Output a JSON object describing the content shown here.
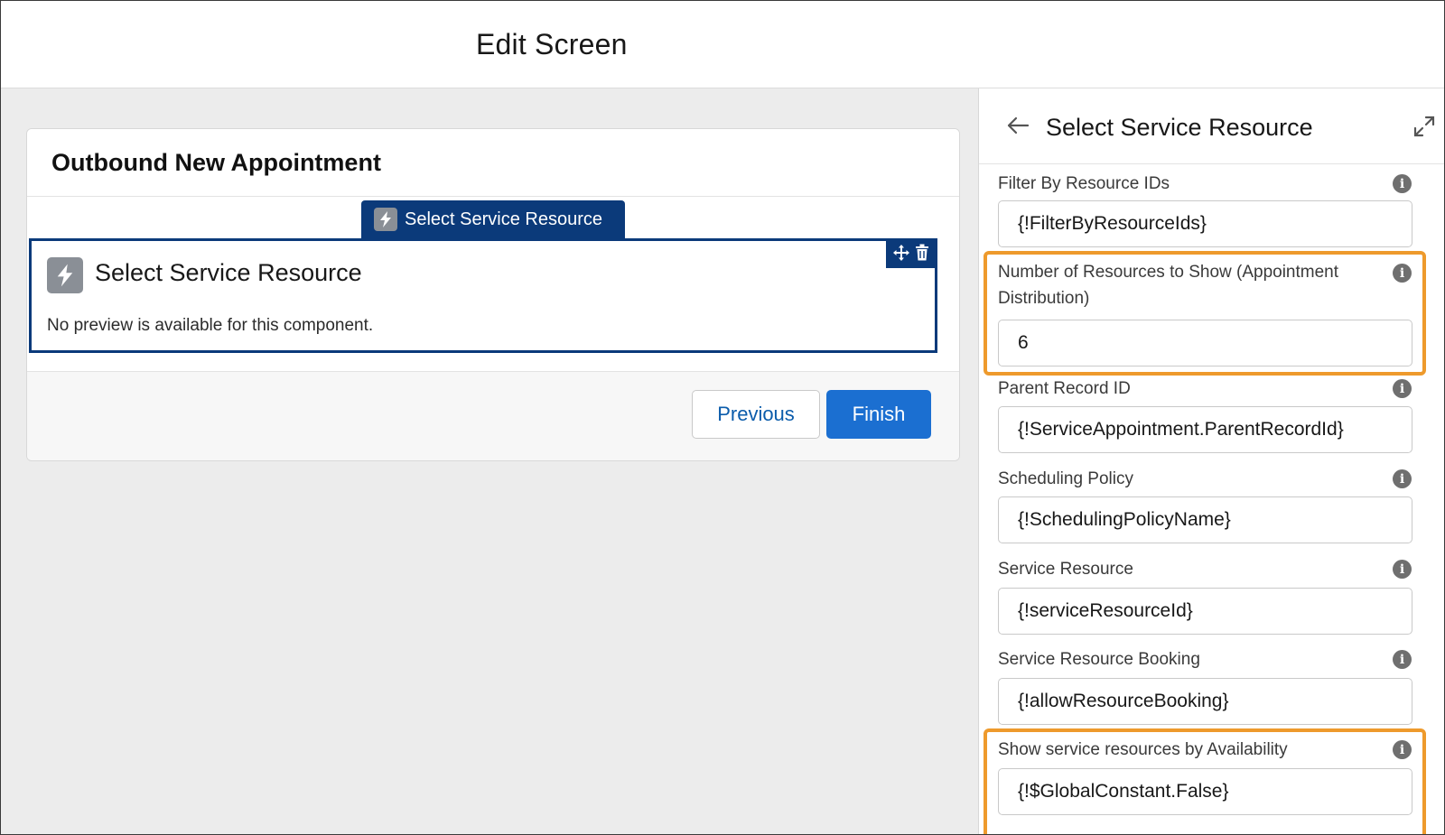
{
  "header": {
    "title": "Edit Screen"
  },
  "canvas": {
    "screen_title": "Outbound New Appointment",
    "component_tab_label": "Select Service Resource",
    "component": {
      "name": "Select Service Resource",
      "note": "No preview is available for this component."
    },
    "footer": {
      "previous_label": "Previous",
      "finish_label": "Finish"
    }
  },
  "panel": {
    "title": "Select Service Resource",
    "fields": [
      {
        "label": "Filter By Resource IDs",
        "value": "{!FilterByResourceIds}",
        "highlighted": false
      },
      {
        "label": "Number of Resources to Show (Appointment Distribution)",
        "value": "6",
        "highlighted": true
      },
      {
        "label": "Parent Record ID",
        "value": "{!ServiceAppointment.ParentRecordId}",
        "highlighted": false
      },
      {
        "label": "Scheduling Policy",
        "value": "{!SchedulingPolicyName}",
        "highlighted": false
      },
      {
        "label": "Service Resource",
        "value": "{!serviceResourceId}",
        "highlighted": false
      },
      {
        "label": "Service Resource Booking",
        "value": "{!allowResourceBooking}",
        "highlighted": false
      },
      {
        "label": "Show service resources by Availability",
        "value": "{!$GlobalConstant.False}",
        "highlighted": true
      }
    ],
    "info_glyph": "i"
  },
  "colors": {
    "accent_dark_blue": "#0b3a7a",
    "brand_blue": "#1b6fd1",
    "highlight_orange": "#ee9a2c",
    "canvas_gray": "#ececec"
  },
  "icons": [
    "lightning-bolt-icon",
    "move-icon",
    "trash-icon",
    "back-arrow-icon",
    "expand-icon",
    "info-icon"
  ]
}
